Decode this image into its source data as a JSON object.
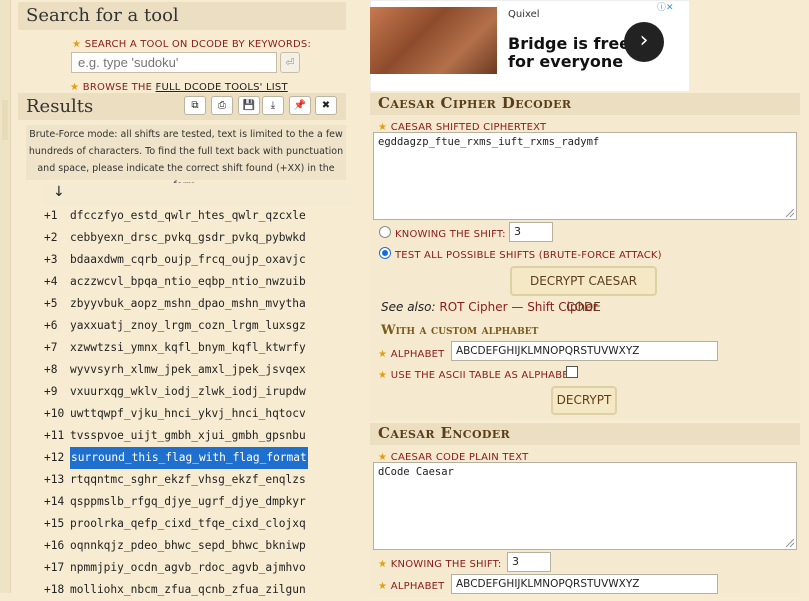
{
  "search": {
    "title": "Search for a tool",
    "keyword_label": "SEARCH A TOOL ON DCODE BY KEYWORDS:",
    "placeholder": "e.g. type 'sudoku'",
    "browse_prefix": "BROWSE THE ",
    "browse_link": "FULL DCODE TOOLS' LIST"
  },
  "results": {
    "title": "Results",
    "toolbar_icons": [
      "copy-icon",
      "print-icon",
      "save-icon",
      "download-icon",
      "pin-icon",
      "close-icon"
    ],
    "toolbar_glyphs": [
      "⧉",
      "⎙",
      "💾",
      "⤓",
      "📌",
      "✖"
    ],
    "note": "Brute-Force mode: all shifts are tested, text is limited to the a few hundreds of characters. To find the full text back with punctuation and space, please indicate the correct shift found (+XX) in the form.",
    "sort_arrow": "↓",
    "rows": [
      {
        "shift": "+1",
        "text": "dfcczfyo_estd_qwlr_htes_qwlr_qzcxle"
      },
      {
        "shift": "+2",
        "text": "cebbyexn_drsc_pvkq_gsdr_pvkq_pybwkd"
      },
      {
        "shift": "+3",
        "text": "bdaaxdwm_cqrb_oujp_frcq_oujp_oxavjc"
      },
      {
        "shift": "+4",
        "text": "aczzwcvl_bpqa_ntio_eqbp_ntio_nwzuib"
      },
      {
        "shift": "+5",
        "text": "zbyyvbuk_aopz_mshn_dpao_mshn_mvytha"
      },
      {
        "shift": "+6",
        "text": "yaxxuatj_znoy_lrgm_cozn_lrgm_luxsgz"
      },
      {
        "shift": "+7",
        "text": "xzwwtzsi_ymnx_kqfl_bnym_kqfl_ktwrfy"
      },
      {
        "shift": "+8",
        "text": "wyvvsyrh_xlmw_jpek_amxl_jpek_jsvqex"
      },
      {
        "shift": "+9",
        "text": "vxuurxqg_wklv_iodj_zlwk_iodj_irupdw"
      },
      {
        "shift": "+10",
        "text": "uwttqwpf_vjku_hnci_ykvj_hnci_hqtocv"
      },
      {
        "shift": "+11",
        "text": "tvsspvoe_uijt_gmbh_xjui_gmbh_gpsnbu"
      },
      {
        "shift": "+12",
        "text": "surround_this_flag_with_flag_format",
        "selected": true
      },
      {
        "shift": "+13",
        "text": "rtqqntmc_sghr_ekzf_vhsg_ekzf_enqlzs"
      },
      {
        "shift": "+14",
        "text": "qsppmslb_rfgq_djye_ugrf_djye_dmpkyr"
      },
      {
        "shift": "+15",
        "text": "proolrka_qefp_cixd_tfqe_cixd_clojxq"
      },
      {
        "shift": "+16",
        "text": "oqnnkqjz_pdeo_bhwc_sepd_bhwc_bkniwp"
      },
      {
        "shift": "+17",
        "text": "npmmjpiy_ocdn_agvb_rdoc_agvb_ajmhvo"
      },
      {
        "shift": "+18",
        "text": "molliohx_nbcm_zfua_qcnb_zfua_zilgun"
      }
    ]
  },
  "ad": {
    "brand": "Quixel",
    "headline_1": "Bridge is free",
    "headline_2": "for everyone",
    "arrow": "›"
  },
  "decoder": {
    "title": "Caesar Cipher Decoder",
    "cipher_label": "CAESAR SHIFTED CIPHERTEXT",
    "cipher_value": "egddagzp_ftue_rxms_iuft_rxms_radymf",
    "knowing_shift_label": "KNOWING THE SHIFT:",
    "shift_value": "3",
    "brute_label": "TEST ALL POSSIBLE SHIFTS (BRUTE-FORCE ATTACK)",
    "decrypt_button": "DECRYPT CAESAR CODE",
    "see_also_label": "See also:",
    "see_also_link1": "ROT Cipher",
    "see_also_sep": " — ",
    "see_also_link2": "Shift Cipher",
    "custom_title": "With a custom alphabet",
    "alphabet_label": "ALPHABET",
    "alphabet_value": "ABCDEFGHIJKLMNOPQRSTUVWXYZ",
    "ascii_label": "USE THE ASCII TABLE AS ALPHABET",
    "decrypt2_button": "DECRYPT"
  },
  "encoder": {
    "title": "Caesar Encoder",
    "plain_label": "CAESAR CODE PLAIN TEXT",
    "plain_value": "dCode Caesar",
    "knowing_shift_label": "KNOWING THE SHIFT:",
    "shift_value": "3",
    "alphabet_label": "ALPHABET",
    "alphabet_value": "ABCDEFGHIJKLMNOPQRSTUVWXYZ"
  }
}
